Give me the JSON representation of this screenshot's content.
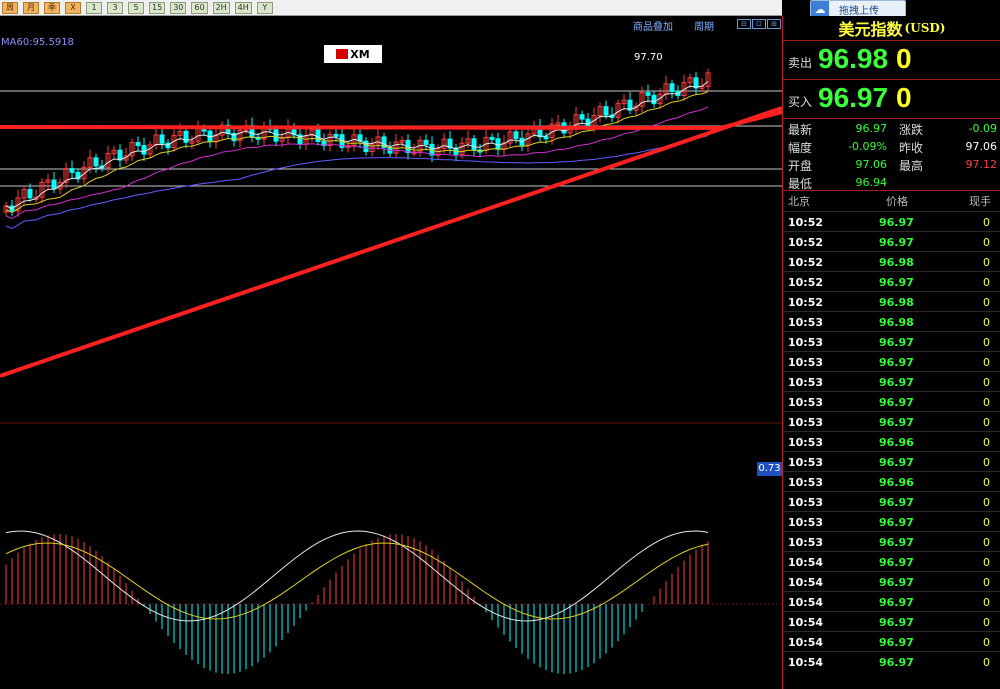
{
  "toolbar": {
    "buttons": [
      "周",
      "月",
      "季",
      "X",
      "1",
      "3",
      "5",
      "15",
      "30",
      "60",
      "2H",
      "4H",
      "Y"
    ]
  },
  "upload_badge": {
    "label": "拖拽上传",
    "icon": "cloud-upload-icon"
  },
  "chart": {
    "ma_label": "MA60:95.5918",
    "overlay_link": "商品叠加",
    "period_link": "周期",
    "high_label": "97.70",
    "logo_text": "XM",
    "macd_tag": "0.73",
    "colors": {
      "up": "#ff3c3c",
      "down": "#00ffff",
      "trendline": "#ff2020"
    }
  },
  "panel": {
    "title": "美元指数",
    "unit": "(USD)",
    "sell": {
      "label": "卖出",
      "price": "96.98",
      "volume": "0"
    },
    "buy": {
      "label": "买入",
      "price": "96.97",
      "volume": "0"
    },
    "stats": {
      "latest_label": "最新",
      "latest_value": "96.97",
      "change_label": "涨跌",
      "change_value": "-0.09",
      "range_label": "幅度",
      "range_value": "-0.09%",
      "prev_close_label": "昨收",
      "prev_close_value": "97.06",
      "open_label": "开盘",
      "open_value": "97.06",
      "high_label": "最高",
      "high_value": "97.12",
      "low_label": "最低",
      "low_value": "96.94"
    },
    "ticks_header": {
      "time": "北京",
      "price": "价格",
      "volume": "现手"
    },
    "ticks": [
      {
        "time": "10:52",
        "price": "96.97",
        "volume": "0"
      },
      {
        "time": "10:52",
        "price": "96.97",
        "volume": "0"
      },
      {
        "time": "10:52",
        "price": "96.98",
        "volume": "0"
      },
      {
        "time": "10:52",
        "price": "96.97",
        "volume": "0"
      },
      {
        "time": "10:52",
        "price": "96.98",
        "volume": "0"
      },
      {
        "time": "10:53",
        "price": "96.98",
        "volume": "0"
      },
      {
        "time": "10:53",
        "price": "96.97",
        "volume": "0"
      },
      {
        "time": "10:53",
        "price": "96.97",
        "volume": "0"
      },
      {
        "time": "10:53",
        "price": "96.97",
        "volume": "0"
      },
      {
        "time": "10:53",
        "price": "96.97",
        "volume": "0"
      },
      {
        "time": "10:53",
        "price": "96.97",
        "volume": "0"
      },
      {
        "time": "10:53",
        "price": "96.96",
        "volume": "0"
      },
      {
        "time": "10:53",
        "price": "96.97",
        "volume": "0"
      },
      {
        "time": "10:53",
        "price": "96.96",
        "volume": "0"
      },
      {
        "time": "10:53",
        "price": "96.97",
        "volume": "0"
      },
      {
        "time": "10:53",
        "price": "96.97",
        "volume": "0"
      },
      {
        "time": "10:53",
        "price": "96.97",
        "volume": "0"
      },
      {
        "time": "10:54",
        "price": "96.97",
        "volume": "0"
      },
      {
        "time": "10:54",
        "price": "96.97",
        "volume": "0"
      },
      {
        "time": "10:54",
        "price": "96.97",
        "volume": "0"
      },
      {
        "time": "10:54",
        "price": "96.97",
        "volume": "0"
      },
      {
        "time": "10:54",
        "price": "96.97",
        "volume": "0"
      },
      {
        "time": "10:54",
        "price": "96.97",
        "volume": "0"
      }
    ]
  }
}
